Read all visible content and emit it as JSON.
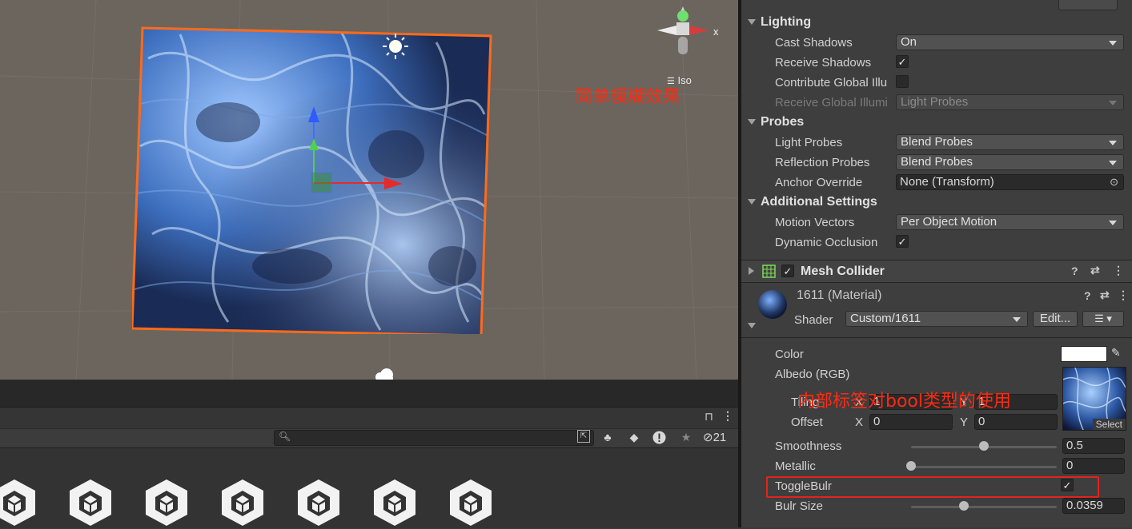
{
  "scene": {
    "annotation_top": "简单模糊效果",
    "annotation_bottom": "内部标签对bool类型的使用",
    "gizmo_axis": "x",
    "gizmo_mode": "Iso",
    "sun_icon": "sun-icon"
  },
  "project_panel": {
    "search_placeholder": "",
    "hidden_count": "21",
    "asset_icon": "unity-logo-icon",
    "asset_count": 7
  },
  "inspector": {
    "lighting": {
      "title": "Lighting",
      "cast_shadows_label": "Cast Shadows",
      "cast_shadows_value": "On",
      "receive_shadows_label": "Receive Shadows",
      "receive_shadows_checked": true,
      "contribute_gi_label": "Contribute Global Illu",
      "contribute_gi_checked": false,
      "receive_gi_label": "Receive Global Illumi",
      "receive_gi_value": "Light Probes"
    },
    "probes": {
      "title": "Probes",
      "light_probes_label": "Light Probes",
      "light_probes_value": "Blend Probes",
      "reflection_probes_label": "Reflection Probes",
      "reflection_probes_value": "Blend Probes",
      "anchor_override_label": "Anchor Override",
      "anchor_override_value": "None (Transform)"
    },
    "additional": {
      "title": "Additional Settings",
      "motion_vectors_label": "Motion Vectors",
      "motion_vectors_value": "Per Object Motion",
      "dynamic_occlusion_label": "Dynamic Occlusion",
      "dynamic_occlusion_checked": true
    },
    "mesh_collider": {
      "title": "Mesh Collider",
      "enabled": true
    },
    "material": {
      "name": "1611 (Material)",
      "shader_label": "Shader",
      "shader_value": "Custom/1611",
      "edit_button": "Edit...",
      "color_label": "Color",
      "color_value": "#ffffff",
      "albedo_label": "Albedo (RGB)",
      "tiling_label": "Tiling",
      "tiling_x_label": "X",
      "tiling_x": "1",
      "tiling_y_label": "Y",
      "tiling_y": "1",
      "offset_label": "Offset",
      "offset_x_label": "X",
      "offset_x": "0",
      "offset_y_label": "Y",
      "offset_y": "0",
      "select_label": "Select",
      "smoothness_label": "Smoothness",
      "smoothness_value": "0.5",
      "smoothness_fraction": 0.5,
      "metallic_label": "Metallic",
      "metallic_value": "0",
      "metallic_fraction": 0.0,
      "toggle_label": "ToggleBulr",
      "toggle_checked": true,
      "bulr_size_label": "Bulr Size",
      "bulr_size_value": "0.0359",
      "bulr_size_fraction": 0.36
    }
  },
  "colors": {
    "selection_outline": "#ff6a1a",
    "annotation": "#ff2a10",
    "highlight_box": "#e3231c"
  }
}
